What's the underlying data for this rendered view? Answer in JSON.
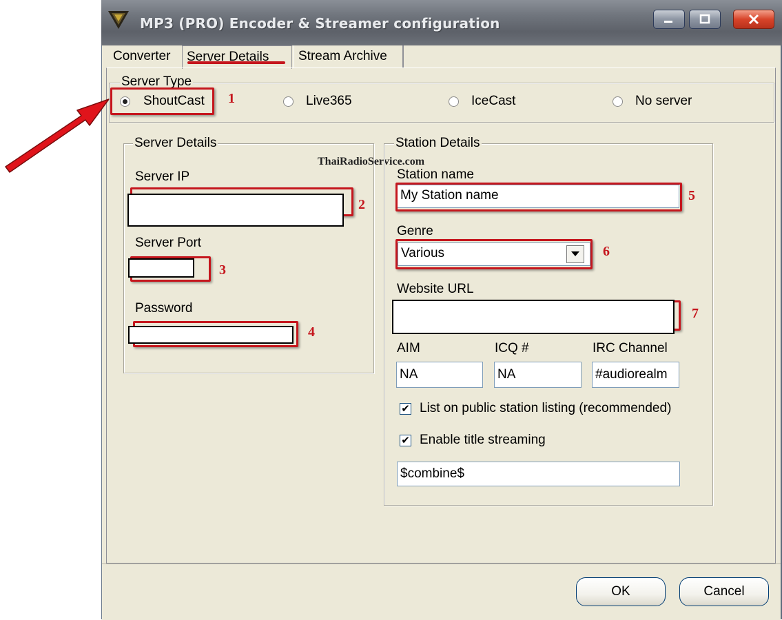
{
  "window": {
    "title": "MP3 (PRO) Encoder & Streamer configuration",
    "controls": {
      "minimize": "minimize-icon",
      "maximize": "maximize-icon",
      "close": "close-icon"
    }
  },
  "tabs": [
    {
      "label": "Converter",
      "active": false
    },
    {
      "label": "Server Details",
      "active": true
    },
    {
      "label": "Stream Archive",
      "active": false
    }
  ],
  "server_type": {
    "legend": "Server Type",
    "options": [
      {
        "label": "ShoutCast",
        "selected": true
      },
      {
        "label": "Live365",
        "selected": false
      },
      {
        "label": "IceCast",
        "selected": false
      },
      {
        "label": "No server",
        "selected": false
      }
    ]
  },
  "server_details": {
    "legend": "Server Details",
    "server_ip_label": "Server IP",
    "server_ip_value": "",
    "server_port_label": "Server Port",
    "server_port_value": "",
    "password_label": "Password",
    "password_value": ""
  },
  "station_details": {
    "legend": "Station Details",
    "station_name_label": "Station name",
    "station_name_value": "My Station name",
    "genre_label": "Genre",
    "genre_value": "Various",
    "website_label": "Website URL",
    "website_value": "",
    "aim_label": "AIM",
    "aim_value": "NA",
    "icq_label": "ICQ #",
    "icq_value": "NA",
    "irc_label": "IRC Channel",
    "irc_value": "#audiorealm",
    "list_public_label": "List on public station listing (recommended)",
    "list_public_checked": true,
    "title_streaming_label": "Enable title streaming",
    "title_streaming_checked": true,
    "title_format_value": "$combine$"
  },
  "buttons": {
    "ok": "OK",
    "cancel": "Cancel"
  },
  "annotations": {
    "watermark": "ThaiRadioService.com",
    "markers": [
      "1",
      "2",
      "3",
      "4",
      "5",
      "6",
      "7"
    ],
    "highlight_color": "#c5161d",
    "arrow_color": "#e0141b"
  }
}
